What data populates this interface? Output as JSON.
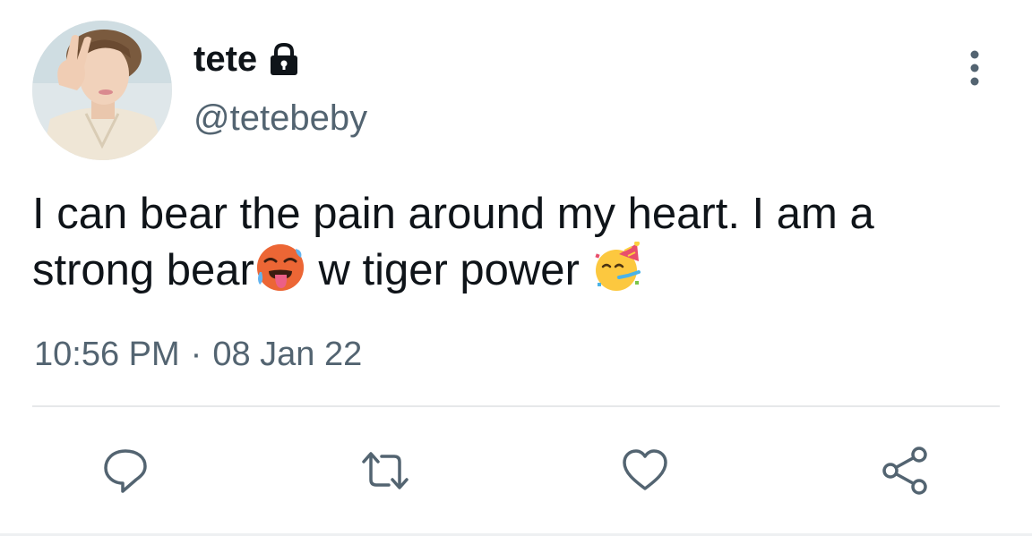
{
  "author": {
    "display_name": "tete",
    "handle": "@tetebeby",
    "protected_icon": "lock-icon",
    "avatar": "profile-photo"
  },
  "tweet": {
    "text_part1": "I can bear the pain around my heart. I am a strong bear",
    "emoji1": "hot-face-emoji",
    "text_part2": " w tiger power ",
    "emoji2": "partying-face-emoji",
    "time": "10:56 PM",
    "separator": "·",
    "date": "08 Jan 22"
  },
  "actions": {
    "reply_icon": "comment-icon",
    "retweet_icon": "retweet-icon",
    "like_icon": "heart-icon",
    "share_icon": "share-icon"
  },
  "menu": {
    "more_icon": "more-vertical-icon"
  },
  "colors": {
    "text": "#0f1419",
    "secondary": "#536471",
    "divider": "#e6e8ea"
  }
}
